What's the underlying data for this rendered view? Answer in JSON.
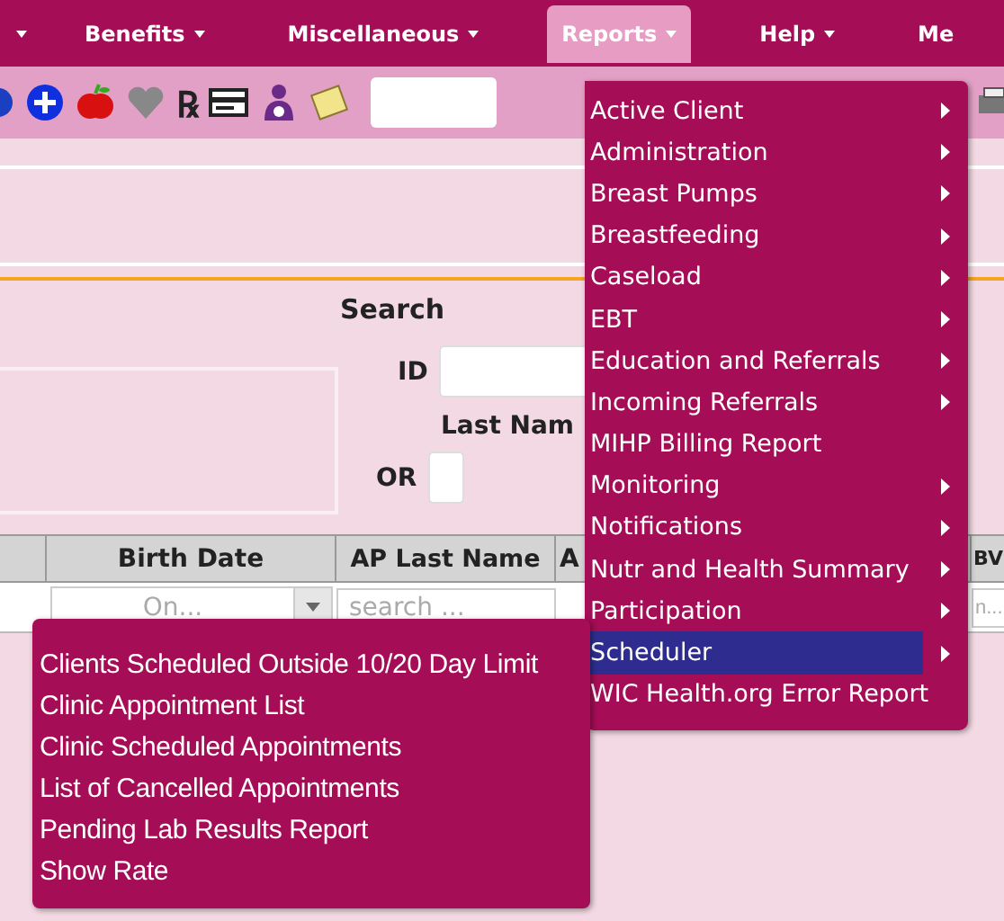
{
  "menubar": [
    {
      "label": "Benefits",
      "selected": false
    },
    {
      "label": "Miscellaneous",
      "selected": false
    },
    {
      "label": "Reports",
      "selected": true
    },
    {
      "label": "Help",
      "selected": false
    },
    {
      "label": "Me",
      "selected": false
    }
  ],
  "toolbar": {
    "rx_glyph": "℞"
  },
  "search": {
    "title": "Search",
    "id_label": "ID",
    "last_name_label": "Last Nam",
    "or_label": "OR"
  },
  "grid": {
    "columns": [
      "Birth Date",
      "AP Last Name",
      "A",
      "BV"
    ],
    "filters": [
      {
        "kind": "select",
        "placeholder": "On..."
      },
      {
        "kind": "text",
        "placeholder": "search ..."
      },
      {
        "kind": "text",
        "placeholder": "n..."
      }
    ]
  },
  "reports_menu": [
    {
      "label": "Active Client",
      "has_submenu": true,
      "selected": false
    },
    {
      "label": "Administration",
      "has_submenu": true,
      "selected": false
    },
    {
      "label": "Breast Pumps",
      "has_submenu": true,
      "selected": false
    },
    {
      "label": "Breastfeeding",
      "has_submenu": true,
      "selected": false
    },
    {
      "label": "Caseload",
      "has_submenu": true,
      "selected": false
    },
    {
      "label": "EBT",
      "has_submenu": true,
      "selected": false
    },
    {
      "label": "Education and Referrals",
      "has_submenu": true,
      "selected": false
    },
    {
      "label": "Incoming Referrals",
      "has_submenu": true,
      "selected": false
    },
    {
      "label": "MIHP Billing Report",
      "has_submenu": false,
      "selected": false
    },
    {
      "label": "Monitoring",
      "has_submenu": true,
      "selected": false
    },
    {
      "label": "Notifications",
      "has_submenu": true,
      "selected": false
    },
    {
      "label": "Nutr and Health Summary",
      "has_submenu": true,
      "selected": false
    },
    {
      "label": "Participation",
      "has_submenu": true,
      "selected": false
    },
    {
      "label": "Scheduler",
      "has_submenu": true,
      "selected": true
    },
    {
      "label": "WIC Health.org Error Report",
      "has_submenu": false,
      "selected": false
    }
  ],
  "scheduler_submenu": [
    "Clients Scheduled Outside 10/20 Day Limit",
    "Clinic Appointment List",
    "Clinic Scheduled Appointments",
    "List of Cancelled Appointments",
    "Pending Lab Results Report",
    "Show Rate"
  ]
}
